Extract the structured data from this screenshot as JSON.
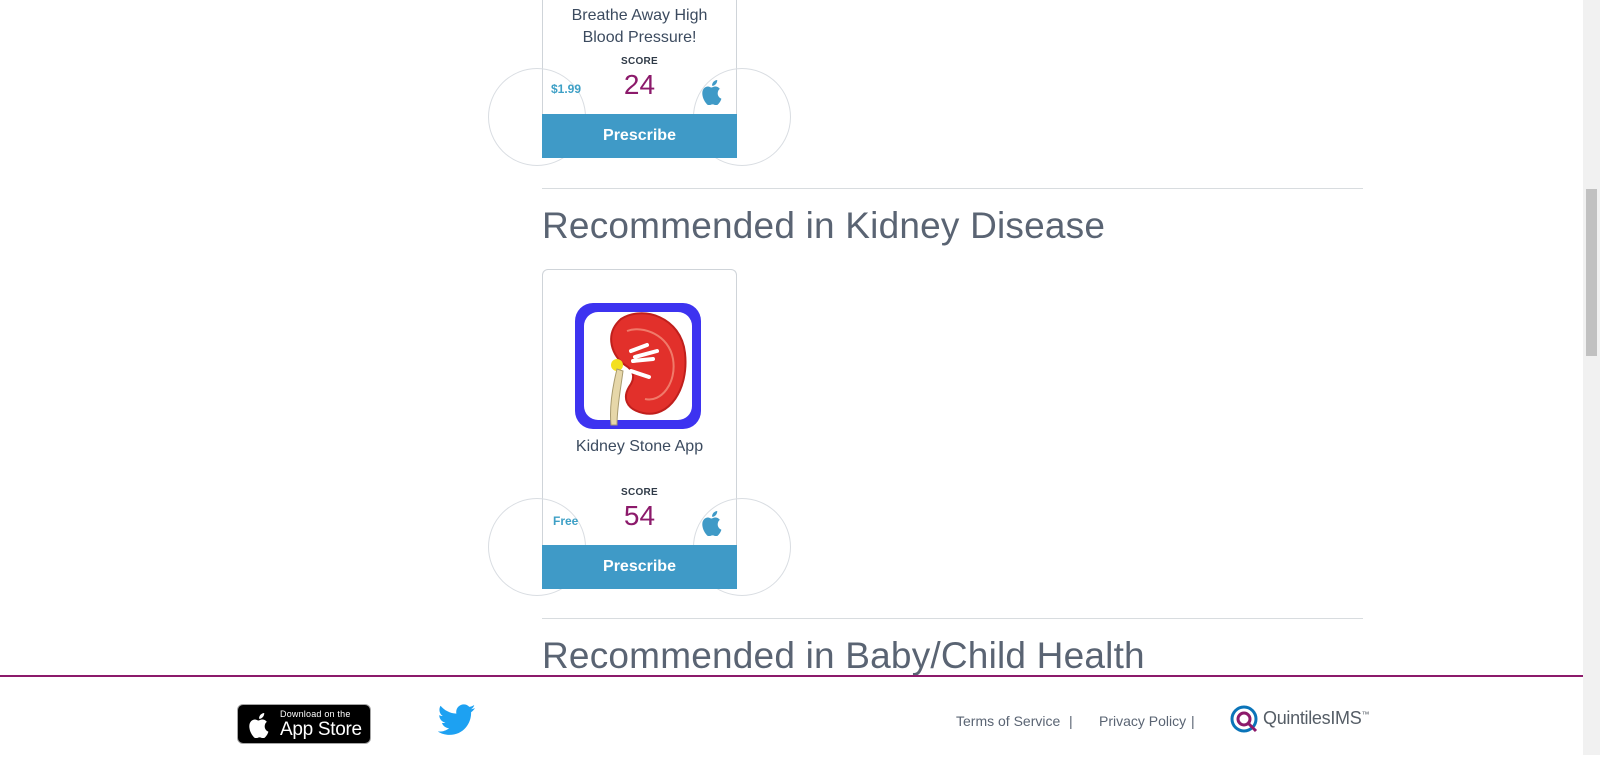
{
  "cards": [
    {
      "name_line1": "Breathe Away High",
      "name_line2": "Blood Pressure!",
      "score_label": "SCORE",
      "score": "24",
      "price": "$1.99",
      "platform_icon": "apple-icon",
      "button": "Prescribe"
    },
    {
      "name": "Kidney Stone App",
      "score_label": "SCORE",
      "score": "54",
      "price": "Free",
      "platform_icon": "apple-icon",
      "button": "Prescribe",
      "image_icon": "kidney-icon"
    }
  ],
  "sections": {
    "kidney": "Recommended in Kidney Disease",
    "baby": "Recommended in Baby/Child Health"
  },
  "footer": {
    "appstore_small": "Download on the",
    "appstore_big": "App Store",
    "terms": "Terms of Service",
    "privacy": "Privacy Policy",
    "separator": "|",
    "brand": "QuintilesIMS",
    "brand_mark": "™"
  },
  "colors": {
    "accent": "#8c1a6b",
    "button": "#3f9ac7",
    "price": "#3ea0c6"
  }
}
